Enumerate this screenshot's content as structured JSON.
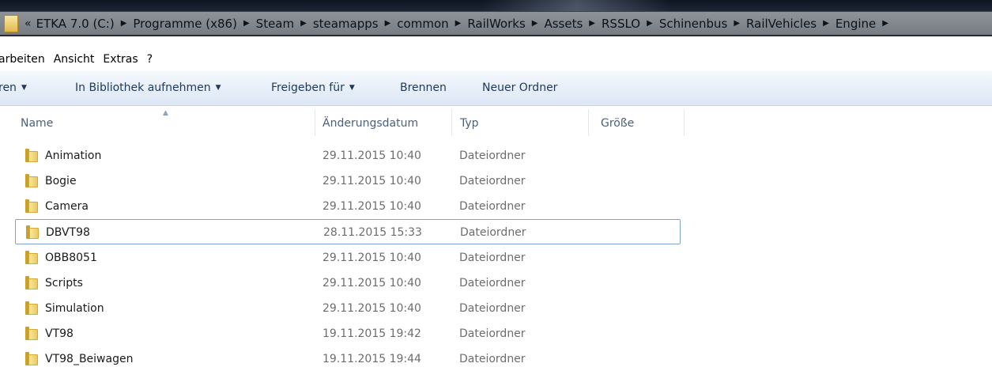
{
  "address_bar": {
    "overflow": "«",
    "crumbs": [
      "ETKA 7.0 (C:)",
      "Programme (x86)",
      "Steam",
      "steamapps",
      "common",
      "RailWorks",
      "Assets",
      "RSSLO",
      "Schinenbus",
      "RailVehicles",
      "Engine"
    ]
  },
  "menu": {
    "items": [
      "arbeiten",
      "Ansicht",
      "Extras",
      "?"
    ]
  },
  "toolbar": {
    "organize_label": "ren",
    "library_label": "In Bibliothek aufnehmen",
    "share_label": "Freigeben für",
    "burn_label": "Brennen",
    "new_folder_label": "Neuer Ordner"
  },
  "columns": {
    "name": "Name",
    "date": "Änderungsdatum",
    "type": "Typ",
    "size": "Größe"
  },
  "files": [
    {
      "name": "Animation",
      "date": "29.11.2015 10:40",
      "type": "Dateiordner",
      "selected": false
    },
    {
      "name": "Bogie",
      "date": "29.11.2015 10:40",
      "type": "Dateiordner",
      "selected": false
    },
    {
      "name": "Camera",
      "date": "29.11.2015 10:40",
      "type": "Dateiordner",
      "selected": false
    },
    {
      "name": "DBVT98",
      "date": "28.11.2015 15:33",
      "type": "Dateiordner",
      "selected": true
    },
    {
      "name": "OBB8051",
      "date": "29.11.2015 10:40",
      "type": "Dateiordner",
      "selected": false
    },
    {
      "name": "Scripts",
      "date": "29.11.2015 10:40",
      "type": "Dateiordner",
      "selected": false
    },
    {
      "name": "Simulation",
      "date": "29.11.2015 10:40",
      "type": "Dateiordner",
      "selected": false
    },
    {
      "name": "VT98",
      "date": "19.11.2015 19:42",
      "type": "Dateiordner",
      "selected": false
    },
    {
      "name": "VT98_Beiwagen",
      "date": "19.11.2015 19:44",
      "type": "Dateiordner",
      "selected": false
    }
  ]
}
